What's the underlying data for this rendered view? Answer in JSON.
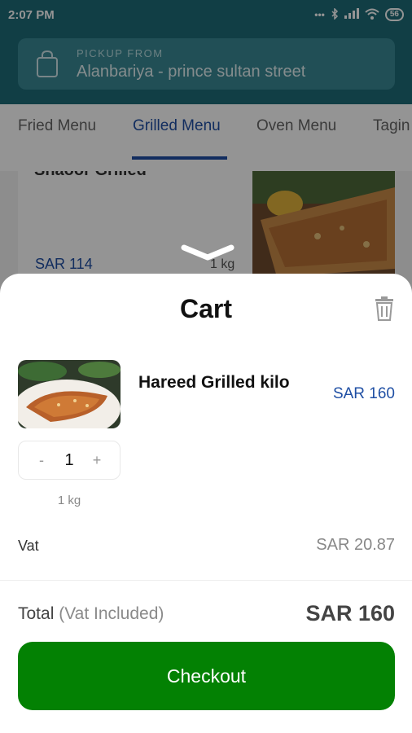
{
  "status_bar": {
    "time": "2:07 PM",
    "icons": [
      "dots-icon",
      "bluetooth-icon",
      "signal-icon",
      "wifi-icon",
      "battery-icon"
    ],
    "battery": "56"
  },
  "pickup": {
    "label": "PICKUP FROM",
    "location": "Alanbariya - prince sultan street"
  },
  "tabs": [
    {
      "label": "Fried Menu",
      "active": false
    },
    {
      "label": "Grilled Menu",
      "active": true
    },
    {
      "label": "Oven Menu",
      "active": false
    },
    {
      "label": "Tagin",
      "active": false
    }
  ],
  "menu_card": {
    "title": "Shaoor Grilled",
    "price": "SAR 114",
    "weight": "1 kg"
  },
  "cart": {
    "title": "Cart",
    "item": {
      "name": "Hareed Grilled kilo",
      "price": "SAR 160",
      "quantity": "1",
      "decrement": "-",
      "increment": "+",
      "weight": "1 kg"
    },
    "vat_label": "Vat",
    "vat_value": "SAR 20.87",
    "total_label": "Total",
    "total_note": "(Vat Included)",
    "total_value": "SAR 160",
    "checkout_label": "Checkout"
  },
  "colors": {
    "header": "#1e6c78",
    "accent_blue": "#1f4fa4",
    "checkout_green": "#038103"
  }
}
